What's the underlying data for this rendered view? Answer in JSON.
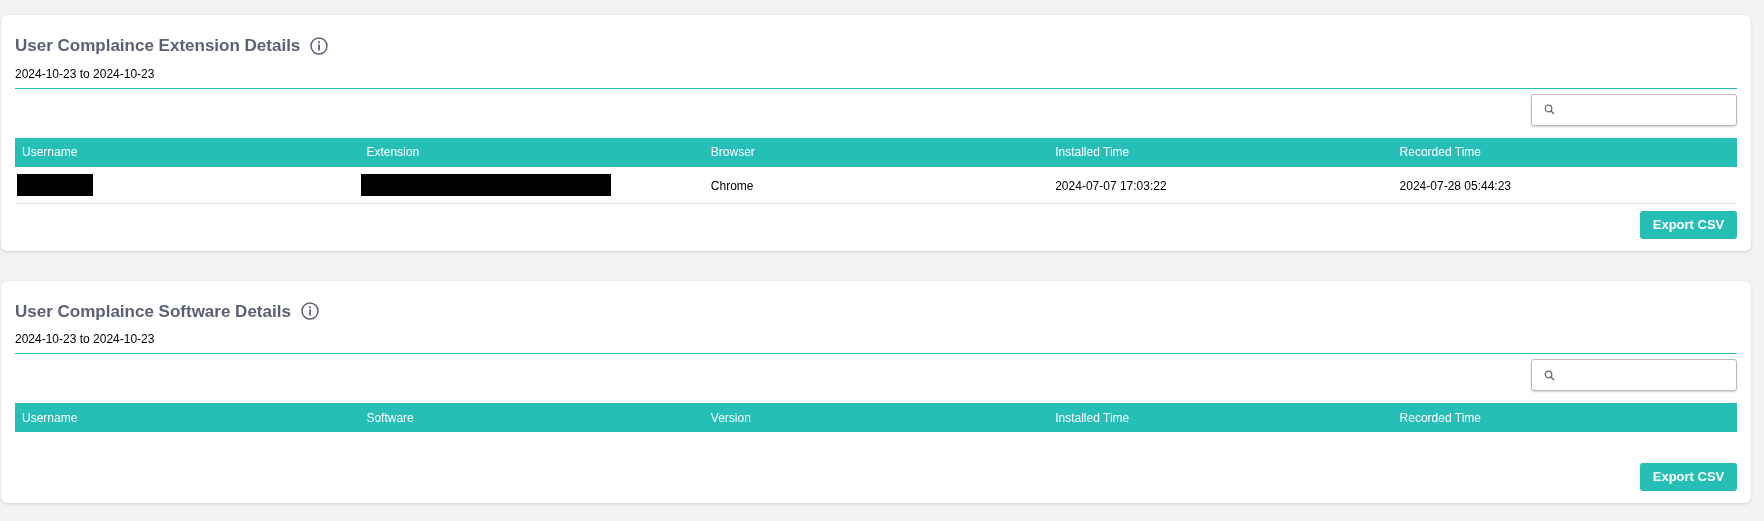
{
  "panels": [
    {
      "title": "User Complaince Extension Details",
      "date_range": "2024-10-23 to 2024-10-23",
      "columns": [
        "Username",
        "Extension",
        "Browser",
        "Installed Time",
        "Recorded Time"
      ],
      "rows": [
        {
          "cells": [
            {
              "kind": "redacted"
            },
            {
              "kind": "redacted"
            },
            {
              "kind": "text",
              "text": "Chrome"
            },
            {
              "kind": "text",
              "text": "2024-07-07 17:03:22"
            },
            {
              "kind": "text",
              "text": "2024-07-28 05:44:23"
            }
          ]
        }
      ],
      "button": "Export CSV"
    },
    {
      "title": "User Complaince Software Details",
      "date_range": "2024-10-23 to 2024-10-23",
      "columns": [
        "Username",
        "Software",
        "Version",
        "Installed Time",
        "Recorded Time"
      ],
      "button": "Export CSV"
    }
  ]
}
